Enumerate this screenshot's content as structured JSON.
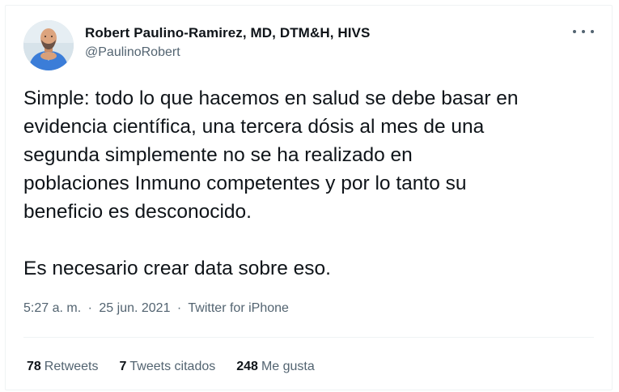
{
  "author": {
    "name": "Robert Paulino-Ramirez, MD, DTM&H, HIVS",
    "handle": "@PaulinoRobert"
  },
  "tweet": {
    "text": "Simple: todo lo que hacemos en salud se debe basar en\nevidencia científica, una tercera dósis al mes de una\nsegunda simplemente no se ha realizado en\npoblaciones Inmuno competentes y por lo tanto su\nbeneficio es desconocido.\n\nEs necesario crear data sobre eso.",
    "time": "5:27 a. m.",
    "date": "25 jun. 2021",
    "source": "Twitter for iPhone",
    "separator": "·"
  },
  "stats": {
    "retweets_count": "78",
    "retweets_label": "Retweets",
    "quotes_count": "7",
    "quotes_label": "Tweets citados",
    "likes_count": "248",
    "likes_label": "Me gusta"
  },
  "icons": {
    "more": "more-options-icon",
    "avatar": "profile-avatar"
  },
  "colors": {
    "text_primary": "#0f1419",
    "text_secondary": "#536471",
    "border": "#eff3f4"
  }
}
